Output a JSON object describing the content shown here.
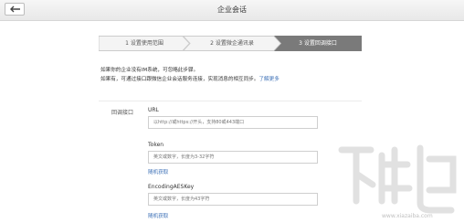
{
  "header": {
    "title": "企业会话"
  },
  "steps": [
    {
      "label": "1 设置使用范围"
    },
    {
      "label": "2 设置微企通讯录"
    },
    {
      "label": "3 设置回调接口"
    }
  ],
  "info": {
    "line1": "如果你的企业没有IM系统，可忽略此步骤。",
    "line2": "如果有，可通过接口跟微信企业会话服务连接，实现消息的相互同步。",
    "link": "了解更多"
  },
  "form": {
    "section_label": "回调接口",
    "url": {
      "label": "URL",
      "placeholder": "以http://或https://开头，支持80或443端口"
    },
    "token": {
      "label": "Token",
      "placeholder": "英文或数字，长度为3-32字符",
      "random_link": "随机获取"
    },
    "aeskey": {
      "label": "EncodingAESKey",
      "placeholder": "英文或数字，长度为43字符",
      "random_link": "随机获取"
    }
  },
  "colors": {
    "active_step": "#7a7a7a",
    "inactive_step": "#f4f4f4",
    "link": "#3b6fb6"
  }
}
